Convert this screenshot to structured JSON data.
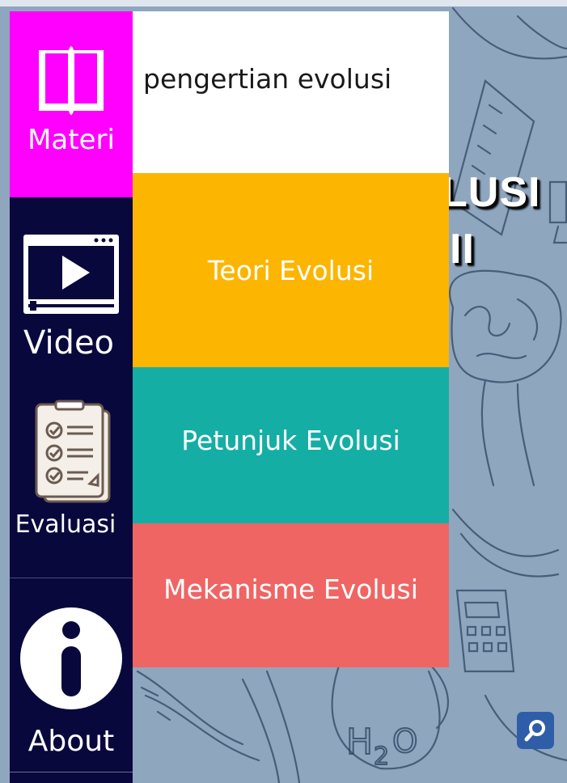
{
  "sidebar": {
    "items": [
      {
        "label": "Materi",
        "icon": "book-icon",
        "active": true
      },
      {
        "label": "Video",
        "icon": "video-player-icon",
        "active": false
      },
      {
        "label": "Evaluasi",
        "icon": "checklist-icon",
        "active": false
      },
      {
        "label": "About",
        "icon": "info-icon",
        "active": false
      }
    ]
  },
  "submenu": {
    "items": [
      {
        "label": "pengertian evolusi",
        "color": "#ffffff"
      },
      {
        "label": "Teori Evolusi",
        "color": "#fcb500"
      },
      {
        "label": "Petunjuk Evolusi",
        "color": "#15aea4"
      },
      {
        "label": "Mekanisme Evolusi",
        "color": "#ef6563"
      }
    ]
  },
  "background_title": {
    "line1_fragment": "LUSI",
    "line2_fragment": "II"
  },
  "zoom": {
    "icon": "search-icon"
  },
  "colors": {
    "sidebar_bg": "#08083d",
    "active_item": "#ff00ff",
    "background": "#8fa6bf"
  }
}
